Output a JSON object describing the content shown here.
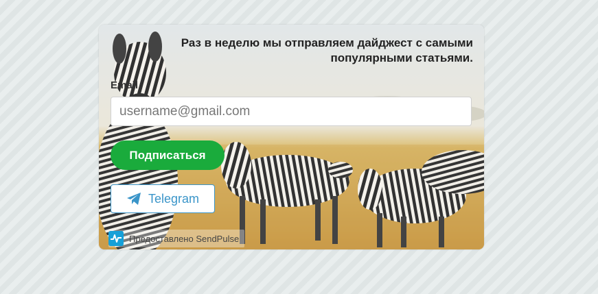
{
  "form": {
    "headline": "Раз в неделю мы отправляем дайджест с самыми популярными статьями.",
    "email_label": "Email",
    "email_placeholder": "username@gmail.com",
    "email_value": "",
    "subscribe_label": "Подписаться",
    "telegram_label": "Telegram",
    "powered_by": "Предоставлено SendPulse"
  },
  "icons": {
    "telegram": "paper-plane-icon",
    "sendpulse": "sendpulse-logo-icon"
  },
  "colors": {
    "subscribe_button": "#1aab3c",
    "telegram_accent": "#3a95c9",
    "sendpulse_brand": "#16a0d8"
  }
}
